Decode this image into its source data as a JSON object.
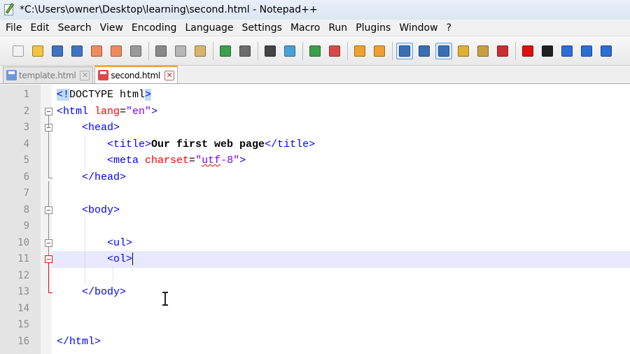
{
  "window": {
    "title": "*C:\\Users\\owner\\Desktop\\learning\\second.html - Notepad++"
  },
  "menu": [
    "File",
    "Edit",
    "Search",
    "View",
    "Encoding",
    "Language",
    "Settings",
    "Macro",
    "Run",
    "Plugins",
    "Window",
    "?"
  ],
  "toolbar": [
    {
      "name": "new-file-icon",
      "color": "#f2f2f2"
    },
    {
      "name": "open-file-icon",
      "color": "#f5c243"
    },
    {
      "name": "save-icon",
      "color": "#3f74c4"
    },
    {
      "name": "save-all-icon",
      "color": "#3f74c4"
    },
    {
      "name": "close-icon",
      "color": "#f08a5d"
    },
    {
      "name": "close-all-icon",
      "color": "#f08a5d"
    },
    {
      "name": "print-icon",
      "color": "#9a9a9a"
    },
    {
      "sep": true
    },
    {
      "name": "cut-icon",
      "color": "#8a8a8a"
    },
    {
      "name": "copy-icon",
      "color": "#b7b7b7"
    },
    {
      "name": "paste-icon",
      "color": "#d9b36b"
    },
    {
      "sep": true
    },
    {
      "name": "undo-icon",
      "color": "#3aa04a"
    },
    {
      "name": "redo-icon",
      "color": "#6c6c6c"
    },
    {
      "sep": true
    },
    {
      "name": "find-icon",
      "color": "#444444"
    },
    {
      "name": "replace-icon",
      "color": "#4aa0d8"
    },
    {
      "sep": true
    },
    {
      "name": "zoom-in-icon",
      "color": "#3aa04a"
    },
    {
      "name": "zoom-out-icon",
      "color": "#d84a4a"
    },
    {
      "sep": true
    },
    {
      "name": "sync-vertical-icon",
      "color": "#f0a030"
    },
    {
      "name": "sync-horizontal-icon",
      "color": "#f0a030"
    },
    {
      "sep": true
    },
    {
      "name": "word-wrap-icon",
      "color": "#3a6fb5",
      "active": true
    },
    {
      "name": "show-all-chars-icon",
      "color": "#3a6fb5"
    },
    {
      "name": "indent-guide-icon",
      "color": "#3a6fb5",
      "active": true
    },
    {
      "name": "user-language-icon",
      "color": "#e0b030"
    },
    {
      "name": "doc-map-icon",
      "color": "#c8a040"
    },
    {
      "name": "function-list-icon",
      "color": "#c83030"
    },
    {
      "sep": true
    },
    {
      "name": "record-macro-icon",
      "color": "#e01010"
    },
    {
      "name": "stop-record-icon",
      "color": "#202020"
    },
    {
      "name": "play-macro-icon",
      "color": "#2a6fd4"
    },
    {
      "name": "play-multiple-icon",
      "color": "#2a6fd4"
    },
    {
      "name": "save-macro-icon",
      "color": "#2a6fd4"
    }
  ],
  "tabs": [
    {
      "label": "template.html",
      "active": false,
      "disk_color": "#6d9ad6"
    },
    {
      "label": "second.html",
      "active": true,
      "disk_color": "#e04848"
    }
  ],
  "editor": {
    "current_line": 11,
    "lines": [
      {
        "num": "1",
        "segments": [
          {
            "t": "<!",
            "c": "tag doctype-hl"
          },
          {
            "t": "DOCTYPE html",
            "c": ""
          },
          {
            "t": ">",
            "c": "tag doctype-hl"
          }
        ]
      },
      {
        "num": "2",
        "segments": [
          {
            "t": "<html ",
            "c": "tag"
          },
          {
            "t": "lang",
            "c": "attr"
          },
          {
            "t": "=",
            "c": ""
          },
          {
            "t": "\"en\"",
            "c": "str"
          },
          {
            "t": ">",
            "c": "tag"
          }
        ]
      },
      {
        "num": "3",
        "segments": [
          {
            "t": "    ",
            "c": ""
          },
          {
            "t": "<head>",
            "c": "tag"
          }
        ]
      },
      {
        "num": "4",
        "segments": [
          {
            "t": "        ",
            "c": ""
          },
          {
            "t": "<title>",
            "c": "tag"
          },
          {
            "t": "Our first web page",
            "c": "txt"
          },
          {
            "t": "</title>",
            "c": "tag"
          }
        ]
      },
      {
        "num": "5",
        "segments": [
          {
            "t": "        ",
            "c": ""
          },
          {
            "t": "<meta ",
            "c": "tag"
          },
          {
            "t": "charset",
            "c": "attr"
          },
          {
            "t": "=",
            "c": ""
          },
          {
            "t": "\"",
            "c": "str"
          },
          {
            "t": "utf",
            "c": "str squiggle"
          },
          {
            "t": "-8\"",
            "c": "str"
          },
          {
            "t": ">",
            "c": "tag"
          }
        ]
      },
      {
        "num": "6",
        "segments": [
          {
            "t": "    ",
            "c": ""
          },
          {
            "t": "</head>",
            "c": "tag"
          }
        ]
      },
      {
        "num": "7",
        "segments": []
      },
      {
        "num": "8",
        "segments": [
          {
            "t": "    ",
            "c": ""
          },
          {
            "t": "<body>",
            "c": "tag"
          }
        ]
      },
      {
        "num": "9",
        "segments": []
      },
      {
        "num": "10",
        "segments": [
          {
            "t": "        ",
            "c": ""
          },
          {
            "t": "<ul>",
            "c": "tag"
          }
        ]
      },
      {
        "num": "11",
        "segments": [
          {
            "t": "        ",
            "c": ""
          },
          {
            "t": "<ol>",
            "c": "tag"
          }
        ],
        "caret": true
      },
      {
        "num": "12",
        "segments": []
      },
      {
        "num": "13",
        "segments": [
          {
            "t": "    ",
            "c": ""
          },
          {
            "t": "</body>",
            "c": "tag"
          }
        ]
      },
      {
        "num": "14",
        "segments": []
      },
      {
        "num": "15",
        "segments": []
      },
      {
        "num": "16",
        "segments": [
          {
            "t": "</html>",
            "c": "tag"
          }
        ]
      }
    ]
  }
}
